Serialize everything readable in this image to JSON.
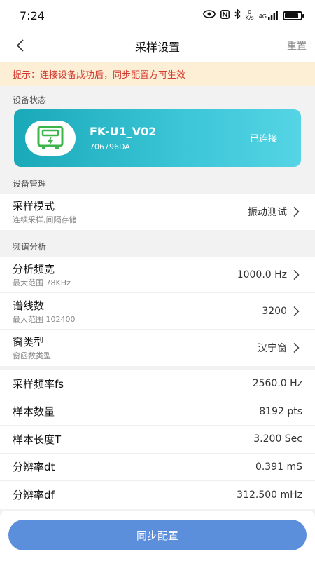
{
  "status_bar": {
    "time": "7:24",
    "net_speed_value": "0",
    "net_speed_unit": "K/s",
    "network": "4G"
  },
  "nav": {
    "title": "采样设置",
    "reset_label": "重置"
  },
  "tip": "提示：连接设备成功后，同步配置方可生效",
  "device_section": {
    "label": "设备状态",
    "name": "FK-U1_V02",
    "id": "706796DA",
    "status": "已连接"
  },
  "management_section": {
    "label": "设备管理",
    "sample_mode": {
      "title": "采样模式",
      "subtitle": "连续采样,间隔存储",
      "value": "振动测试"
    }
  },
  "spectrum_section": {
    "label": "频谱分析",
    "rows": [
      {
        "title": "分析频宽",
        "subtitle": "最大范围 78KHz",
        "value": "1000.0 Hz"
      },
      {
        "title": "谱线数",
        "subtitle": "最大范围 102400",
        "value": "3200"
      },
      {
        "title": "窗类型",
        "subtitle": "窗函数类型",
        "value": "汉宁窗"
      }
    ]
  },
  "params": [
    {
      "title": "采样频率fs",
      "value": "2560.0 Hz"
    },
    {
      "title": "样本数量",
      "value": "8192 pts"
    },
    {
      "title": "样本长度T",
      "value": "3.200 Sec"
    },
    {
      "title": "分辨率dt",
      "value": "0.391 mS"
    },
    {
      "title": "分辨率df",
      "value": "312.500 mHz"
    }
  ],
  "sync_button_label": "同步配置",
  "colors": {
    "accent": "#5b8fdc",
    "card_gradient_start": "#1aa9b8",
    "card_gradient_end": "#55d4e4",
    "device_icon": "#3cb54a",
    "tip_text": "#d43a2f",
    "tip_bg": "#fcefd5"
  }
}
